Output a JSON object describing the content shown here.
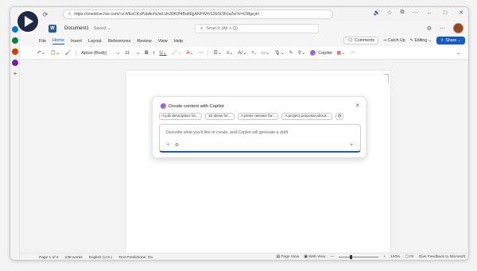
{
  "browser": {
    "url": "https://onedrive.live.com/:w:/t/EaCKsPsbAchtJwLUn30K0f4BubEjjANFWrhS2bSC8UaZw?e=CMgxyH"
  },
  "app": {
    "doc_name": "Document1",
    "saved": "Saved ⌄",
    "search_placeholder": "Search (Alt + Q)",
    "logo_letter": "W"
  },
  "menu": {
    "items": [
      "File",
      "Home",
      "Insert",
      "Layout",
      "References",
      "Review",
      "View",
      "Help"
    ],
    "comments": "Comments",
    "catch_up": "Catch Up",
    "editing": "Editing ⌄",
    "share": "Share ⌄"
  },
  "ribbon": {
    "font_name": "Aptos (Body)",
    "font_size": "11",
    "copilot": "Copilot"
  },
  "dialog": {
    "title": "Create content with Copilot",
    "chips": [
      "A job description for...",
      "10 ideas for...",
      "A press release for...",
      "A project proposal about..."
    ],
    "prompt_placeholder": "Describe what you'd like to create, and Copilot will generate a draft"
  },
  "status": {
    "page": "Page 1 of 4",
    "words": "238 words",
    "language": "English (U.S.)",
    "predictions": "Text Predictions: On",
    "page_view": "Page View",
    "web_view": "Web View",
    "zoom": "100%",
    "fit": "Fit",
    "feedback": "Give Feedback to Microsoft"
  },
  "colors": {
    "accent": "#185abd",
    "word_blue": "#2b5797"
  }
}
